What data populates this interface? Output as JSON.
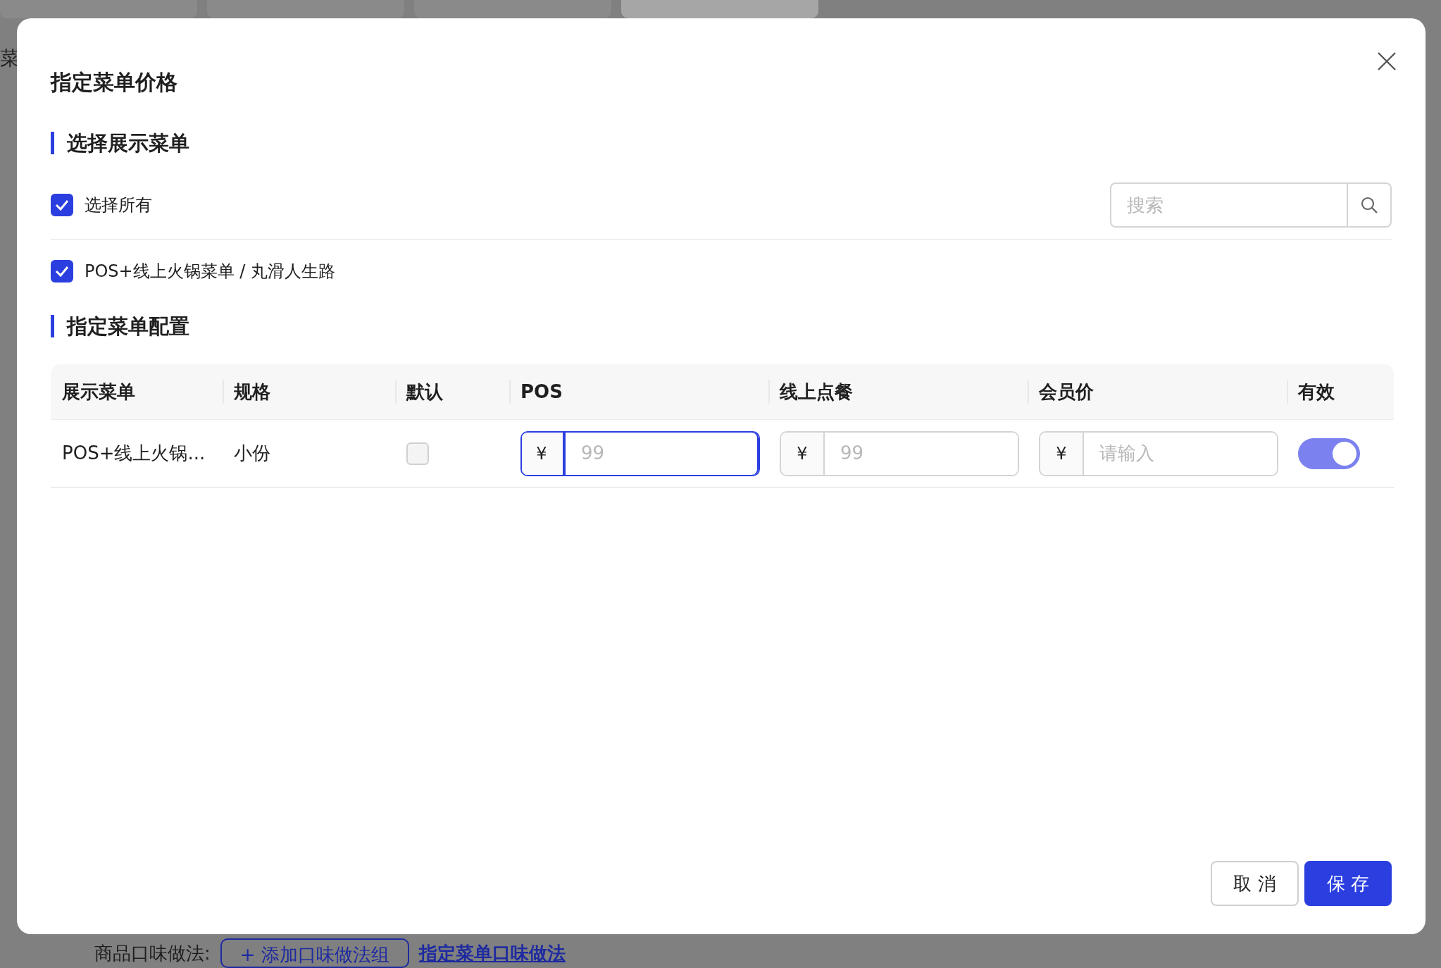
{
  "background": {
    "tabs": [
      {
        "selected": false
      },
      {
        "selected": false
      },
      {
        "selected": false
      },
      {
        "selected": true
      }
    ],
    "side_label": "菜",
    "flavor_label": "商品口味做法:",
    "add_flavor_button": "+ 添加口味做法组",
    "flavor_link": "指定菜单口味做法"
  },
  "dialog": {
    "title": "指定菜单价格",
    "section_1": "选择展示菜单",
    "select_all": {
      "label": "选择所有",
      "checked": true
    },
    "search": {
      "placeholder": "搜索"
    },
    "menus": [
      {
        "label": "POS+线上火锅菜单 / 丸滑人生路",
        "checked": true
      }
    ],
    "section_2": "指定菜单配置",
    "table": {
      "columns": [
        "展示菜单",
        "规格",
        "默认",
        "POS",
        "线上点餐",
        "会员价",
        "有效"
      ],
      "rows": [
        {
          "menu": "POS+线上火锅...",
          "spec": "小份",
          "default": false,
          "prices": [
            {
              "prefix": "¥",
              "placeholder": "99",
              "focused": true
            },
            {
              "prefix": "¥",
              "placeholder": "99",
              "focused": false
            },
            {
              "prefix": "¥",
              "placeholder": "请输入",
              "focused": false
            }
          ],
          "valid": true
        }
      ]
    },
    "buttons": {
      "cancel": "取 消",
      "save": "保 存"
    }
  }
}
